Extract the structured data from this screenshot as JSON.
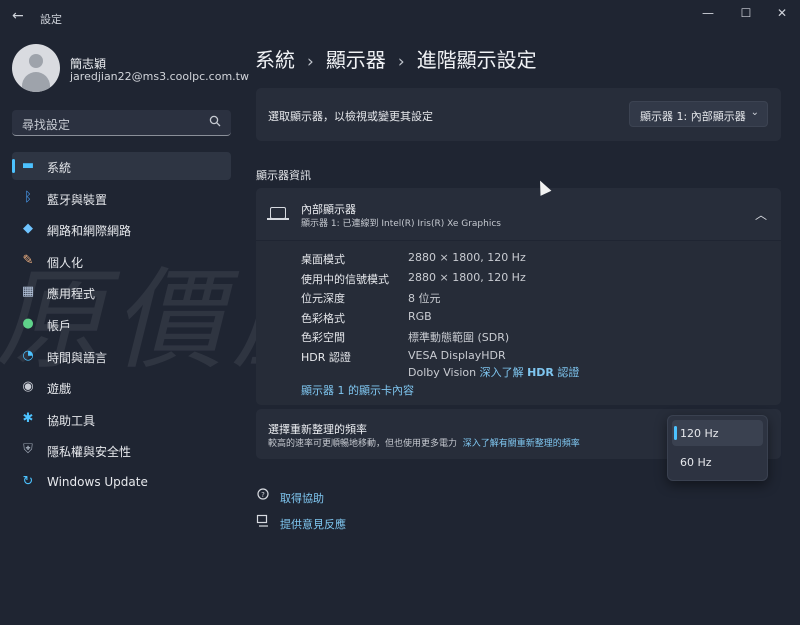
{
  "window": {
    "title": "設定",
    "back_glyph": "←",
    "min_glyph": "—",
    "max_glyph": "☐",
    "close_glyph": "✕"
  },
  "user": {
    "name": "簡志穎",
    "email": "jaredjian22@ms3.coolpc.com.tw"
  },
  "search": {
    "placeholder": "尋找設定",
    "icon": "search-icon"
  },
  "sidebar": {
    "items": [
      {
        "label": "系統",
        "icon": "monitor-icon",
        "glyph": "▬",
        "color": "#4cc2ff",
        "active": true
      },
      {
        "label": "藍牙與裝置",
        "icon": "bluetooth-icon",
        "glyph": "ᛒ",
        "color": "#4ca4ff"
      },
      {
        "label": "網路和網際網路",
        "icon": "wifi-icon",
        "glyph": "◆",
        "color": "#6fc4ff"
      },
      {
        "label": "個人化",
        "icon": "brush-icon",
        "glyph": "✎",
        "color": "#f0b080"
      },
      {
        "label": "應用程式",
        "icon": "apps-icon",
        "glyph": "▦",
        "color": "#b8c8e0"
      },
      {
        "label": "帳戶",
        "icon": "account-icon",
        "glyph": "●",
        "color": "#5fd38a"
      },
      {
        "label": "時間與語言",
        "icon": "globe-clock-icon",
        "glyph": "◔",
        "color": "#4cc2ff"
      },
      {
        "label": "遊戲",
        "icon": "gamepad-icon",
        "glyph": "◉",
        "color": "#c8ccd4"
      },
      {
        "label": "協助工具",
        "icon": "accessibility-icon",
        "glyph": "✱",
        "color": "#4cc2ff"
      },
      {
        "label": "隱私權與安全性",
        "icon": "shield-icon",
        "glyph": "⛨",
        "color": "#9aa3b0"
      },
      {
        "label": "Windows Update",
        "icon": "update-icon",
        "glyph": "↻",
        "color": "#4cc2ff"
      }
    ]
  },
  "breadcrumb": {
    "items": [
      "系統",
      "顯示器",
      "進階顯示設定"
    ],
    "separator": "›"
  },
  "select_display": {
    "label": "選取顯示器，以檢視或變更其設定",
    "value": "顯示器 1: 內部顯示器",
    "chevron": "⌄"
  },
  "section": {
    "title": "顯示器資訊"
  },
  "display_info": {
    "name": "內部顯示器",
    "subtitle": "顯示器 1: 已連線到 Intel(R) Iris(R) Xe Graphics",
    "chevron": "︿",
    "rows": [
      {
        "key": "桌面模式",
        "value": "2880 × 1800, 120 Hz"
      },
      {
        "key": "使用中的信號模式",
        "value": "2880 × 1800, 120 Hz"
      },
      {
        "key": "位元深度",
        "value": "8 位元"
      },
      {
        "key": "色彩格式",
        "value": "RGB"
      },
      {
        "key": "色彩空間",
        "value": "標準動態範圍 (SDR)"
      }
    ],
    "hdr": {
      "key": "HDR 認證",
      "value": "VESA DisplayHDR",
      "value2_prefix": "Dolby Vision",
      "link_text": "深入了解",
      "link_bold": "HDR",
      "link_suffix": "認證"
    },
    "adapter_link": "顯示器 1 的顯示卡內容"
  },
  "refresh_rate": {
    "title": "選擇重新整理的頻率",
    "desc": "較高的速率可更順暢地移動，但也使用更多電力",
    "link": "深入了解有關重新整理的頻率",
    "options": [
      "120 Hz",
      "60 Hz"
    ],
    "selected": "120 Hz"
  },
  "help": {
    "get_help": "取得協助",
    "feedback": "提供意見反應"
  },
  "watermark": "原價屋coolpc"
}
